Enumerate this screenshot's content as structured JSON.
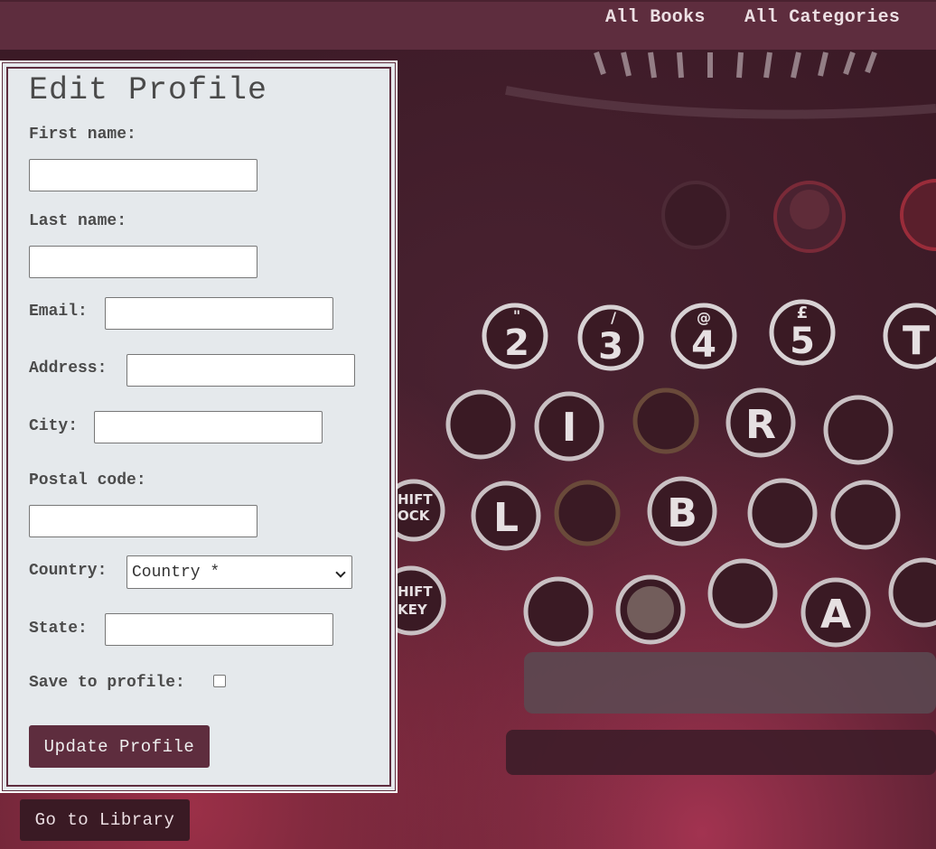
{
  "nav": {
    "all_books": "All Books",
    "all_categories": "All Categories"
  },
  "form": {
    "title": "Edit Profile",
    "first_name_label": "First name:",
    "first_name_value": "",
    "last_name_label": "Last name:",
    "last_name_value": "",
    "email_label": "Email:",
    "email_value": "",
    "address_label": "Address:",
    "address_value": "",
    "city_label": "City:",
    "city_value": "",
    "postal_code_label": "Postal code:",
    "postal_code_value": "",
    "country_label": "Country:",
    "country_selected": "Country *",
    "state_label": "State:",
    "state_value": "",
    "save_label": "Save to profile:",
    "save_checked": false,
    "submit_label": "Update Profile"
  },
  "footer": {
    "library_label": "Go to Library"
  },
  "background": {
    "key_letters": [
      "2",
      "3",
      "4",
      "5",
      "T",
      "I",
      "R",
      "L",
      "B",
      "A"
    ],
    "key_shift_symbols": [
      "\"",
      "/",
      "@",
      "£"
    ],
    "side_keys": [
      "HIFT OCK",
      "HIFT KEY"
    ]
  },
  "colors": {
    "accent": "#5e2d3e",
    "card_bg": "#e5e9ec",
    "text": "#4b4b4b"
  }
}
